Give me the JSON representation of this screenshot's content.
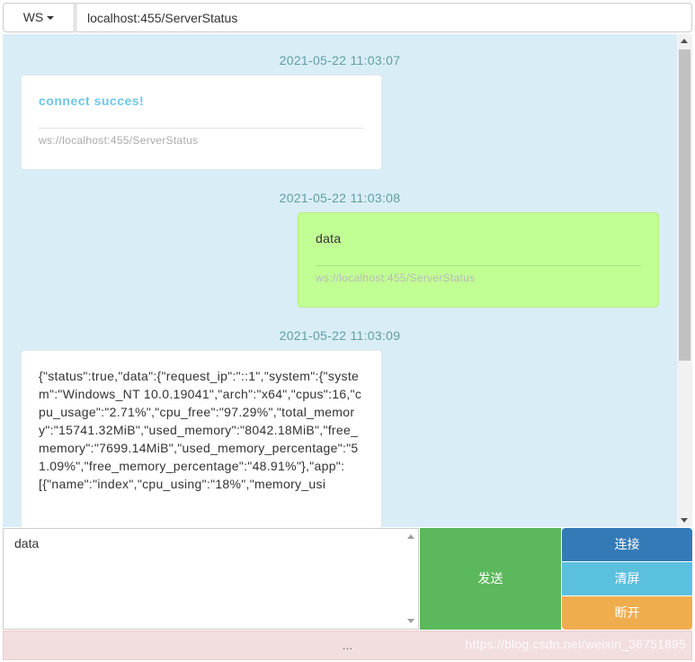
{
  "toolbar": {
    "protocol_label": "WS",
    "url_value": "localhost:455/ServerStatus"
  },
  "messages": [
    {
      "timestamp": "2021-05-22 11:03:07",
      "side": "left",
      "content": "connect succes!",
      "source": "ws://localhost:455/ServerStatus"
    },
    {
      "timestamp": "2021-05-22 11:03:08",
      "side": "right",
      "content": "data",
      "source": "ws://localhost:455/ServerStatus"
    },
    {
      "timestamp": "2021-05-22 11:03:09",
      "side": "left",
      "content": "{\"status\":true,\"data\":{\"request_ip\":\"::1\",\"system\":{\"system\":\"Windows_NT 10.0.19041\",\"arch\":\"x64\",\"cpus\":16,\"cpu_usage\":\"2.71%\",\"cpu_free\":\"97.29%\",\"total_memory\":\"15741.32MiB\",\"used_memory\":\"8042.18MiB\",\"free_memory\":\"7699.14MiB\",\"used_memory_percentage\":\"51.09%\",\"free_memory_percentage\":\"48.91%\"},\"app\":[{\"name\":\"index\",\"cpu_using\":\"18%\",\"memory_usi"
    }
  ],
  "composer": {
    "value": "data"
  },
  "buttons": {
    "send": "发送",
    "connect": "连接",
    "clear": "清屏",
    "disconnect": "断开"
  },
  "status_text": "...",
  "watermark": "https://blog.csdn.net/weixin_36751895"
}
